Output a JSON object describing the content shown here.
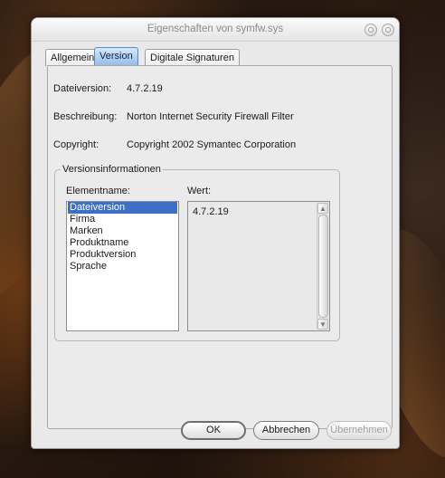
{
  "window": {
    "title": "Eigenschaften von symfw.sys"
  },
  "tabs": [
    {
      "label": "Allgemein"
    },
    {
      "label": "Version"
    },
    {
      "label": "Digitale Signaturen"
    }
  ],
  "info": {
    "file_version_label": "Dateiversion:",
    "file_version_value": "4.7.2.19",
    "description_label": "Beschreibung:",
    "description_value": "Norton Internet Security Firewall Filter",
    "copyright_label": "Copyright:",
    "copyright_value": "Copyright 2002 Symantec Corporation"
  },
  "version_group": {
    "title": "Versionsinformationen",
    "item_name_label": "Elementname:",
    "value_label": "Wert:",
    "items": [
      "Dateiversion",
      "Firma",
      "Marken",
      "Produktname",
      "Produktversion",
      "Sprache"
    ],
    "selected_index": 0,
    "selected_value": "4.7.2.19"
  },
  "buttons": {
    "ok": "OK",
    "cancel": "Abbrechen",
    "apply": "Übernehmen"
  },
  "colors": {
    "selection": "#3d6fc6",
    "active_tab": "#8eb8e8"
  }
}
